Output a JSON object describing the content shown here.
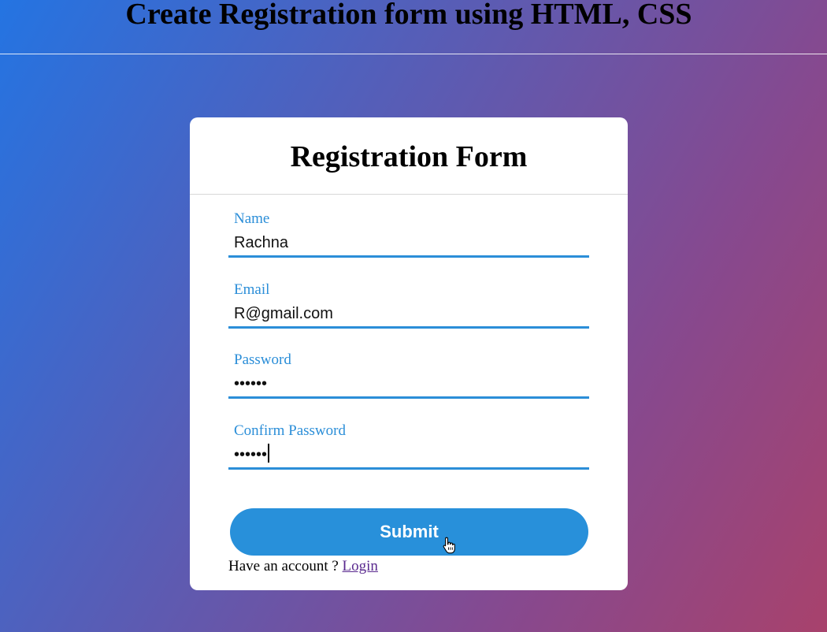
{
  "page": {
    "heading": "Create Registration form using HTML, CSS"
  },
  "form": {
    "title": "Registration Form",
    "fields": [
      {
        "label": "Name",
        "value": "Rachna"
      },
      {
        "label": "Email",
        "value": "R@gmail.com"
      },
      {
        "label": "Password",
        "value": "••••••"
      },
      {
        "label": "Confirm Password",
        "value": "••••••"
      }
    ],
    "submit_label": "Submit",
    "account_prompt": "Have an account ? ",
    "login_label": "Login"
  },
  "colors": {
    "accent": "#2b8ed8",
    "button": "#2890da",
    "gradient_start": "#2474e2",
    "gradient_end": "#a8426c"
  },
  "icons": {
    "cursor": "hand-pointer-icon"
  }
}
